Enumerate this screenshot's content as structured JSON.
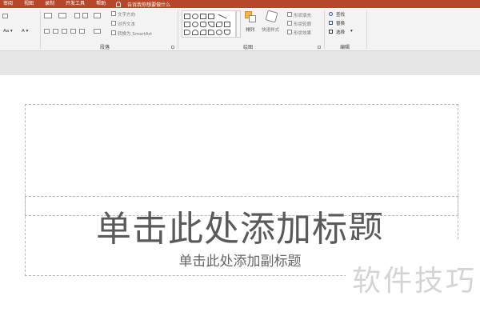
{
  "tabs": [
    "审阅",
    "视图",
    "录制",
    "开发工具",
    "帮助"
  ],
  "tell_me": "告诉我你想要做什么",
  "ribbon": {
    "paragraph": {
      "group_label": "段落",
      "text_direction": "文字方向",
      "align_text": "对齐文本",
      "convert_smartart": "转换为 SmartArt"
    },
    "drawing": {
      "group_label": "绘图",
      "arrange": "排列",
      "quick_styles": "快速样式",
      "shape_fill": "形状填充",
      "shape_outline": "形状轮廓",
      "shape_effects": "形状效果"
    },
    "editing": {
      "group_label": "编辑",
      "find": "查找",
      "replace": "替换",
      "select": "选择"
    }
  },
  "slide": {
    "title_placeholder": "单击此处添加标题",
    "subtitle_placeholder": "单击此处添加副标题"
  },
  "watermark": "软件技巧",
  "colors": {
    "tab_bar": "#b7472a",
    "ribbon_bg": "#f3f3f3",
    "workspace": "#e6e6e6"
  }
}
